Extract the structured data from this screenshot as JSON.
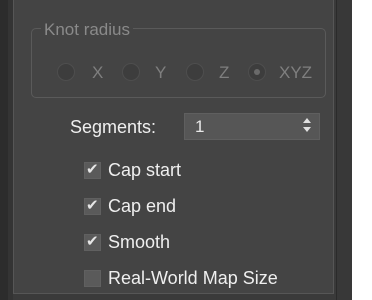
{
  "group": {
    "title": "Knot radius"
  },
  "radios": [
    {
      "label": "X",
      "checked": false
    },
    {
      "label": "Y",
      "checked": false
    },
    {
      "label": "Z",
      "checked": false
    },
    {
      "label": "XYZ",
      "checked": true
    }
  ],
  "segments": {
    "label": "Segments:",
    "value": "1"
  },
  "checkboxes": [
    {
      "label": "Cap start",
      "checked": true
    },
    {
      "label": "Cap end",
      "checked": true
    },
    {
      "label": "Smooth",
      "checked": true
    },
    {
      "label": "Real-World Map Size",
      "checked": false
    }
  ],
  "check_glyph": "✔"
}
